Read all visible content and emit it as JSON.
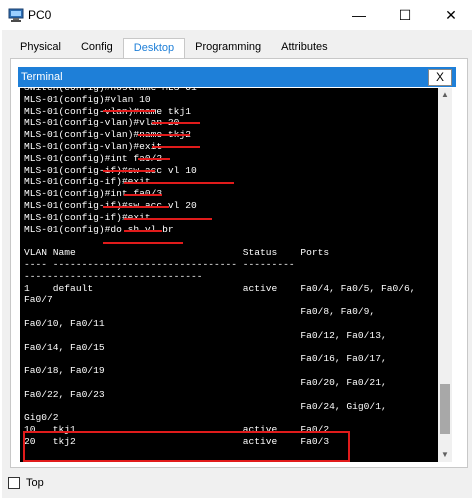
{
  "window": {
    "title": "PC0",
    "minimize_symbol": "—",
    "maximize_symbol": "☐",
    "close_symbol": "✕"
  },
  "tabs": [
    {
      "label": "Physical"
    },
    {
      "label": "Config"
    },
    {
      "label": "Desktop",
      "active": true
    },
    {
      "label": "Programming"
    },
    {
      "label": "Attributes"
    }
  ],
  "terminal": {
    "title": "Terminal",
    "close_label": "X",
    "lines": [
      "Switch(config)#hostname MLS-01",
      "MLS-01(config)#vlan 10",
      "MLS-01(config-vlan)#name tkj1",
      "MLS-01(config-vlan)#vlan 20",
      "MLS-01(config-vlan)#name tkj2",
      "MLS-01(config-vlan)#exit",
      "MLS-01(config)#int fa0/2",
      "MLS-01(config-if)#sw acc vl 10",
      "MLS-01(config-if)#exit",
      "MLS-01(config)#int fa0/3",
      "MLS-01(config-if)#sw acc vl 20",
      "MLS-01(config-if)#exit",
      "MLS-01(config)#do sh vl br",
      "",
      "VLAN Name                             Status    Ports",
      "---- -------------------------------- --------- ",
      "-------------------------------",
      "1    default                          active    Fa0/4, Fa0/5, Fa0/6,",
      "Fa0/7",
      "                                                Fa0/8, Fa0/9,",
      "Fa0/10, Fa0/11",
      "                                                Fa0/12, Fa0/13,",
      "Fa0/14, Fa0/15",
      "                                                Fa0/16, Fa0/17,",
      "Fa0/18, Fa0/19",
      "                                                Fa0/20, Fa0/21,",
      "Fa0/22, Fa0/23",
      "                                                Fa0/24, Gig0/1,",
      "Gig0/2",
      "10   tkj1                             active    Fa0/2",
      "20   tkj2                             active    Fa0/3"
    ],
    "annotation_color": "#e11b1b"
  },
  "footer": {
    "top_label": "Top",
    "top_checked": false
  },
  "colors": {
    "accent": "#1e7fd8",
    "terminal_bg": "#000000",
    "terminal_fg": "#ffffff"
  }
}
